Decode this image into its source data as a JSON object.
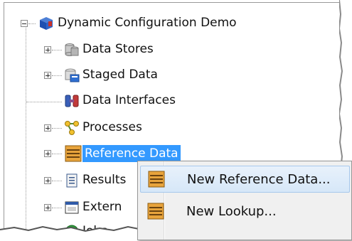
{
  "tree": {
    "root_label": "Dynamic Configuration Demo",
    "items": [
      {
        "label": "Data Stores",
        "icon": "database-icon"
      },
      {
        "label": "Staged Data",
        "icon": "staged-data-icon"
      },
      {
        "label": "Data Interfaces",
        "icon": "data-interface-icon"
      },
      {
        "label": "Processes",
        "icon": "process-icon"
      },
      {
        "label": "Reference Data",
        "icon": "reference-data-icon",
        "selected": true
      },
      {
        "label": "Results",
        "icon": "results-icon"
      },
      {
        "label": "Extern",
        "icon": "external-icon"
      },
      {
        "label": "Jobs",
        "icon": "jobs-icon"
      }
    ]
  },
  "context_menu": {
    "items": [
      {
        "label": "New Reference Data...",
        "icon": "reference-data-icon",
        "highlighted": true
      },
      {
        "label": "New Lookup...",
        "icon": "lookup-icon"
      }
    ]
  },
  "colors": {
    "selection": "#3399ff",
    "reference_data_icon": "#e8a43c"
  }
}
